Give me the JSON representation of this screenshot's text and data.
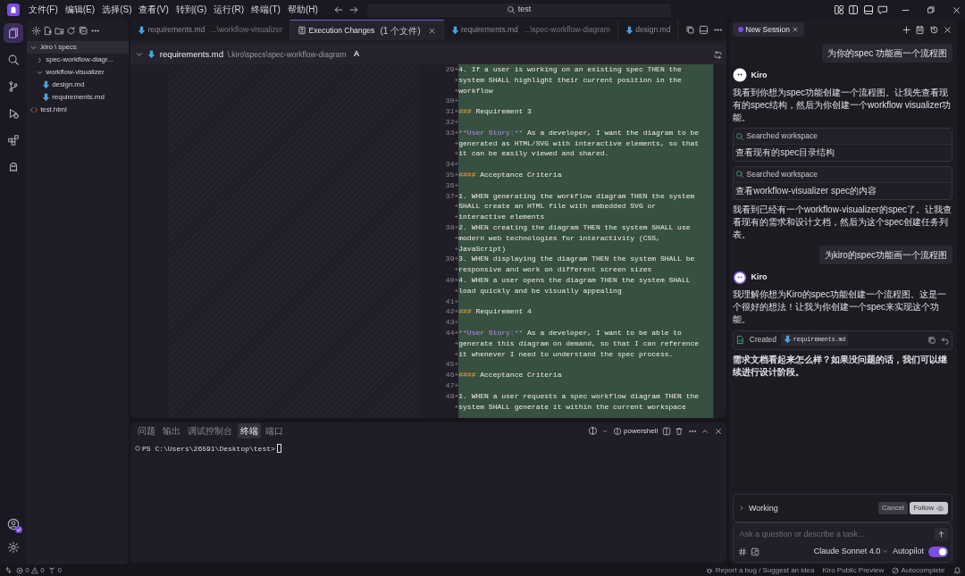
{
  "menu": [
    "文件(F)",
    "编辑(E)",
    "选择(S)",
    "查看(V)",
    "转到(G)",
    "运行(R)",
    "终端(T)",
    "帮助(H)"
  ],
  "command_center": {
    "value": "test"
  },
  "activity_bar": [
    {
      "selected": true
    },
    {
      "selected": false
    },
    {
      "selected": false
    },
    {
      "selected": false
    },
    {
      "selected": false
    },
    {
      "selected": false
    }
  ],
  "explorer": {
    "tree": [
      {
        "label": ".kiro \\ specs",
        "kind": "folder",
        "expanded": true,
        "selected": true,
        "children": [
          {
            "label": "spec-workflow-diagr...",
            "kind": "folder",
            "expanded": false,
            "selected": false
          },
          {
            "label": "workflow-visualizer",
            "kind": "folder",
            "expanded": true,
            "selected": false,
            "children": [
              {
                "label": "design.md",
                "kind": "markdown",
                "selected": false
              },
              {
                "label": "requirements.md",
                "kind": "markdown",
                "selected": false
              }
            ]
          }
        ]
      },
      {
        "label": "test.html",
        "kind": "html",
        "selected": false
      }
    ]
  },
  "editor_tabs": [
    {
      "label": "requirements.md",
      "description": "...\\workflow-visualizer",
      "kind": "markdown",
      "selected": false
    },
    {
      "label": "Execution Changes",
      "description": "(1 个文件)",
      "kind": "diff",
      "selected": true
    },
    {
      "label": "requirements.md",
      "description": "...\\spec-workflow-diagram",
      "kind": "markdown",
      "selected": false
    },
    {
      "label": "design.md",
      "kind": "markdown",
      "selected": false
    }
  ],
  "diff_header": {
    "file": "requirements.md",
    "path": "\\.kiro\\specs\\spec-workflow-diagram",
    "status": "A",
    "expanded": true
  },
  "diff_lines": [
    {
      "number": "29",
      "marker": "+",
      "rows": [
        [
          {
            "kind": "plain",
            "text": "4. If a user is working on an existing spec THEN the"
          }
        ],
        [
          {
            "kind": "plain",
            "text": "system SHALL highlight their current position in the"
          }
        ],
        [
          {
            "kind": "plain",
            "text": "workflow"
          }
        ]
      ]
    },
    {
      "number": "30",
      "marker": "+"
    },
    {
      "number": "31",
      "marker": "+",
      "rows": [
        [
          {
            "kind": "heading",
            "text": "###"
          },
          {
            "kind": "plain",
            "text": " Requirement 3"
          }
        ]
      ]
    },
    {
      "number": "32",
      "marker": "+"
    },
    {
      "number": "33",
      "marker": "+",
      "rows": [
        [
          {
            "kind": "strong",
            "text": "**User Story:**"
          },
          {
            "kind": "plain",
            "text": " As a developer, I want the diagram to be"
          }
        ],
        [
          {
            "kind": "plain",
            "text": "generated as HTML/SVG with interactive elements, so that"
          }
        ],
        [
          {
            "kind": "plain",
            "text": "it can be easily viewed and shared."
          }
        ]
      ]
    },
    {
      "number": "34",
      "marker": "+"
    },
    {
      "number": "35",
      "marker": "+",
      "rows": [
        [
          {
            "kind": "heading",
            "text": "####"
          },
          {
            "kind": "plain",
            "text": " Acceptance Criteria"
          }
        ]
      ]
    },
    {
      "number": "36",
      "marker": "+"
    },
    {
      "number": "37",
      "marker": "+",
      "rows": [
        [
          {
            "kind": "plain",
            "text": "1. WHEN generating the workflow diagram THEN the system"
          }
        ],
        [
          {
            "kind": "plain",
            "text": "SHALL create an HTML file with embedded SVG or"
          }
        ],
        [
          {
            "kind": "plain",
            "text": "interactive elements"
          }
        ]
      ]
    },
    {
      "number": "38",
      "marker": "+",
      "rows": [
        [
          {
            "kind": "plain",
            "text": "2. WHEN creating the diagram THEN the system SHALL use"
          }
        ],
        [
          {
            "kind": "plain",
            "text": "modern web technologies for interactivity (CSS,"
          }
        ],
        [
          {
            "kind": "plain",
            "text": "JavaScript)"
          }
        ]
      ]
    },
    {
      "number": "39",
      "marker": "+",
      "rows": [
        [
          {
            "kind": "plain",
            "text": "3. WHEN displaying the diagram THEN the system SHALL be"
          }
        ],
        [
          {
            "kind": "plain",
            "text": "responsive and work on different screen sizes"
          }
        ]
      ]
    },
    {
      "number": "40",
      "marker": "+",
      "rows": [
        [
          {
            "kind": "plain",
            "text": "4. WHEN a user opens the diagram THEN the system SHALL"
          }
        ],
        [
          {
            "kind": "plain",
            "text": "load quickly and be visually appealing"
          }
        ]
      ]
    },
    {
      "number": "41",
      "marker": "+"
    },
    {
      "number": "42",
      "marker": "+",
      "rows": [
        [
          {
            "kind": "heading",
            "text": "###"
          },
          {
            "kind": "plain",
            "text": " Requirement 4"
          }
        ]
      ]
    },
    {
      "number": "43",
      "marker": "+"
    },
    {
      "number": "44",
      "marker": "+",
      "rows": [
        [
          {
            "kind": "strong",
            "text": "**User Story:**"
          },
          {
            "kind": "plain",
            "text": " As a developer, I want to be able to"
          }
        ],
        [
          {
            "kind": "plain",
            "text": "generate this diagram on demand, so that I can reference"
          }
        ],
        [
          {
            "kind": "plain",
            "text": "it whenever I need to understand the spec process."
          }
        ]
      ]
    },
    {
      "number": "45",
      "marker": "+"
    },
    {
      "number": "46",
      "marker": "+",
      "rows": [
        [
          {
            "kind": "heading",
            "text": "####"
          },
          {
            "kind": "plain",
            "text": " Acceptance Criteria"
          }
        ]
      ]
    },
    {
      "number": "47",
      "marker": "+"
    },
    {
      "number": "48",
      "marker": "+",
      "rows": [
        [
          {
            "kind": "plain",
            "text": "1. WHEN a user requests a spec workflow diagram THEN the"
          }
        ],
        [
          {
            "kind": "plain",
            "text": "system SHALL generate it within the current workspace"
          }
        ]
      ]
    }
  ],
  "panel": {
    "tabs": [
      {
        "label": "问题",
        "selected": false
      },
      {
        "label": "输出",
        "selected": false
      },
      {
        "label": "调试控制台",
        "selected": false
      },
      {
        "label": "终端",
        "selected": true
      },
      {
        "label": "端口",
        "selected": false
      }
    ],
    "shell": "powershell",
    "prompt": "PS C:\\Users\\26591\\Desktop\\test>"
  },
  "chat": {
    "tab": "New Session",
    "messages": [
      {
        "kind": "user",
        "text": "为你的spec 功能画一个流程图"
      },
      {
        "kind": "agent",
        "name": "Kiro",
        "active": false
      },
      {
        "kind": "text",
        "text": "我看到你想为spec功能创建一个流程图。让我先查看现有的spec结构，然后为你创建一个workflow visualizer功能。"
      },
      {
        "kind": "search",
        "title": "Searched workspace",
        "detail": "查看现有的spec目录结构"
      },
      {
        "kind": "search",
        "title": "Searched workspace",
        "detail": "查看workflow-visualizer spec的内容"
      },
      {
        "kind": "text",
        "text": "我看到已经有一个workflow-visualizer的spec了。让我查看现有的需求和设计文档，然后为这个spec创建任务列表。"
      },
      {
        "kind": "user",
        "text": "为kiro的spec功能画一个流程图"
      },
      {
        "kind": "agent",
        "name": "Kiro",
        "active": true
      },
      {
        "kind": "text",
        "text": "我理解你想为Kiro的spec功能创建一个流程图。这是一个很好的想法！让我为你创建一个spec来实现这个功能。"
      },
      {
        "kind": "created",
        "title": "Created",
        "file": "requirements.md"
      },
      {
        "kind": "question",
        "text": "需求文档看起来怎么样？如果没问题的话，我们可以继续进行设计阶段。"
      }
    ],
    "status": {
      "label": "Working",
      "cancel": "Cancel",
      "follow": "Follow"
    },
    "input": {
      "placeholder": "Ask a question or describe a task..."
    },
    "model": "Claude Sonnet 4.0",
    "autopilot": {
      "label": "Autopilot",
      "on": true
    }
  },
  "status_bar": {
    "errors": "0",
    "warnings": "0",
    "ports": "0",
    "right": [
      "Report a bug / Suggest an idea",
      "Kiro Public Preview",
      "Autocomplete"
    ]
  }
}
